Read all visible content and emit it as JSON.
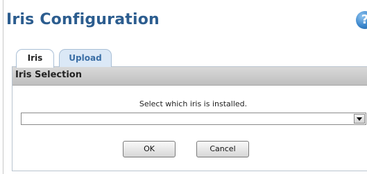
{
  "page": {
    "title": "Iris Configuration",
    "help_icon_glyph": "?"
  },
  "tabs": [
    {
      "label": "Iris",
      "active": true
    },
    {
      "label": "Upload",
      "active": false
    }
  ],
  "panel": {
    "title": "Iris Selection",
    "instruction": "Select which iris is installed.",
    "select": {
      "value": ""
    }
  },
  "buttons": {
    "ok_label": "OK",
    "cancel_label": "Cancel"
  },
  "colors": {
    "title": "#2c5d8f",
    "tab_inactive_bg": "#dbe8f6",
    "tab_inactive_text": "#3a6ea5",
    "panel_header_bg": "#c8c8c8"
  },
  "icons": {
    "help": "help-icon",
    "dropdown": "chevron-down-icon"
  }
}
